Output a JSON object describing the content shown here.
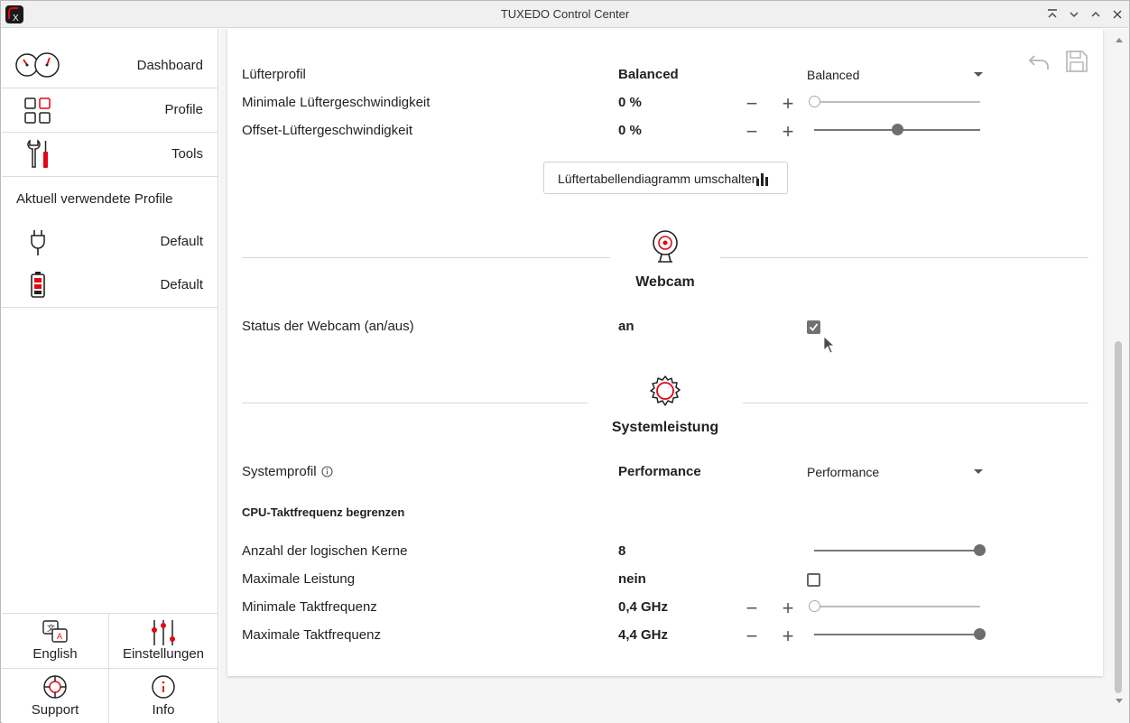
{
  "window": {
    "title": "TUXEDO Control Center"
  },
  "sidebar": {
    "nav": [
      {
        "label": "Dashboard",
        "icon": "dashboard-gauges-icon"
      },
      {
        "label": "Profile",
        "icon": "profile-grid-icon"
      },
      {
        "label": "Tools",
        "icon": "tools-icon"
      }
    ],
    "active_profiles_title": "Aktuell verwendete Profile",
    "active_profiles": [
      {
        "label": "Default",
        "icon": "power-plug-icon"
      },
      {
        "label": "Default",
        "icon": "battery-icon"
      }
    ],
    "bottom": [
      {
        "label": "English",
        "icon": "language-icon"
      },
      {
        "label": "Einstellungen",
        "icon": "settings-sliders-icon"
      },
      {
        "label": "Support",
        "icon": "lifebuoy-icon"
      },
      {
        "label": "Info",
        "icon": "info-icon"
      }
    ]
  },
  "fan": {
    "rows": [
      {
        "label": "Lüfterprofil",
        "value": "Balanced",
        "select": "Balanced"
      },
      {
        "label": "Minimale Lüftergeschwindigkeit",
        "value": "0 %",
        "slider": 0
      },
      {
        "label": "Offset-Lüftergeschwindigkeit",
        "value": "0 %",
        "slider": 0.5
      }
    ],
    "toggle_button": "Lüftertabellendiagramm umschalten"
  },
  "webcam": {
    "title": "Webcam",
    "rows": [
      {
        "label": "Status der Webcam (an/aus)",
        "value": "an",
        "checked": true
      }
    ]
  },
  "system": {
    "title": "Systemleistung",
    "profile": {
      "label": "Systemprofil",
      "value": "Performance",
      "select": "Performance"
    },
    "cpu_heading": "CPU-Taktfrequenz begrenzen",
    "rows": [
      {
        "label": "Anzahl der logischen Kerne",
        "value": "8",
        "slider": 1
      },
      {
        "label": "Maximale Leistung",
        "value": "nein",
        "checked": false
      },
      {
        "label": "Minimale Taktfrequenz",
        "value": "0,4 GHz",
        "slider": 0
      },
      {
        "label": "Maximale Taktfrequenz",
        "value": "4,4 GHz",
        "slider": 1
      }
    ]
  },
  "colors": {
    "accent": "#e30613",
    "icon_gray": "#555555"
  }
}
